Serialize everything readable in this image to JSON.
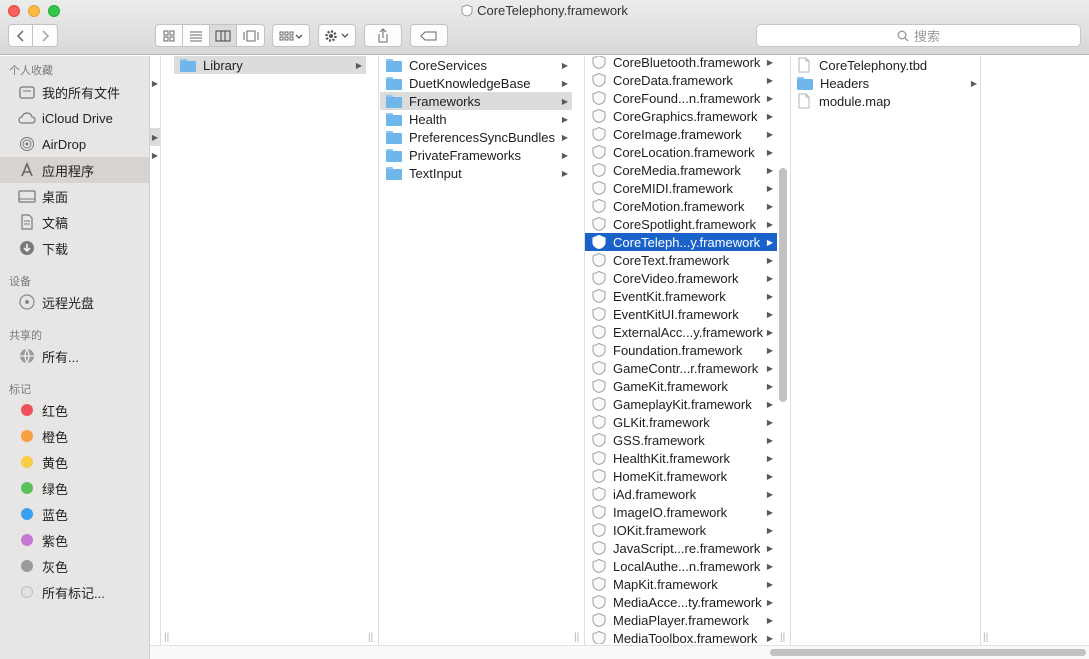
{
  "window": {
    "title": "CoreTelephony.framework",
    "lights": {
      "close": "#fc605b",
      "minimize": "#fdbc40",
      "zoom": "#34c84a"
    }
  },
  "toolbar": {
    "search_placeholder": "搜索",
    "icons": [
      "chevron-left-icon",
      "chevron-right-icon",
      "icon-view-icon",
      "list-view-icon",
      "column-view-icon",
      "coverflow-view-icon",
      "group-icon",
      "gear-icon",
      "share-icon",
      "tag-icon"
    ]
  },
  "sidebar": {
    "favorites_header": "个人收藏",
    "favorites": [
      {
        "label": "我的所有文件",
        "icon": "all-files-icon"
      },
      {
        "label": "iCloud Drive",
        "icon": "cloud-icon"
      },
      {
        "label": "AirDrop",
        "icon": "airdrop-icon"
      },
      {
        "label": "应用程序",
        "icon": "applications-icon",
        "selected": true
      },
      {
        "label": "桌面",
        "icon": "desktop-icon"
      },
      {
        "label": "文稿",
        "icon": "documents-icon"
      },
      {
        "label": "下载",
        "icon": "download-icon"
      }
    ],
    "devices_header": "设备",
    "devices": [
      {
        "label": "远程光盘",
        "icon": "disc-icon"
      }
    ],
    "shared_header": "共享的",
    "shared": [
      {
        "label": "所有...",
        "icon": "network-icon"
      }
    ],
    "tags_header": "标记",
    "tags": [
      {
        "label": "红色",
        "color": "#f0525a"
      },
      {
        "label": "橙色",
        "color": "#f5a041"
      },
      {
        "label": "黄色",
        "color": "#f7cd47"
      },
      {
        "label": "绿色",
        "color": "#5ac05b"
      },
      {
        "label": "蓝色",
        "color": "#3aa1f0"
      },
      {
        "label": "紫色",
        "color": "#c27ad5"
      },
      {
        "label": "灰色",
        "color": "#9a9a9a"
      },
      {
        "label": "所有标记...",
        "color": "#e2e2e2"
      }
    ]
  },
  "columns": {
    "library": [
      {
        "label": "Library",
        "selected": true
      }
    ],
    "library_children": [
      {
        "label": "CoreServices"
      },
      {
        "label": "DuetKnowledgeBase"
      },
      {
        "label": "Frameworks",
        "selected": true
      },
      {
        "label": "Health"
      },
      {
        "label": "PreferencesSyncBundles"
      },
      {
        "label": "PrivateFrameworks"
      },
      {
        "label": "TextInput"
      }
    ],
    "frameworks": [
      {
        "label": "CoreBluetooth.framework"
      },
      {
        "label": "CoreData.framework"
      },
      {
        "label": "CoreFound...n.framework"
      },
      {
        "label": "CoreGraphics.framework"
      },
      {
        "label": "CoreImage.framework"
      },
      {
        "label": "CoreLocation.framework"
      },
      {
        "label": "CoreMedia.framework"
      },
      {
        "label": "CoreMIDI.framework"
      },
      {
        "label": "CoreMotion.framework"
      },
      {
        "label": "CoreSpotlight.framework"
      },
      {
        "label": "CoreTeleph...y.framework",
        "highlighted": true
      },
      {
        "label": "CoreText.framework"
      },
      {
        "label": "CoreVideo.framework"
      },
      {
        "label": "EventKit.framework"
      },
      {
        "label": "EventKitUI.framework"
      },
      {
        "label": "ExternalAcc...y.framework"
      },
      {
        "label": "Foundation.framework"
      },
      {
        "label": "GameContr...r.framework"
      },
      {
        "label": "GameKit.framework"
      },
      {
        "label": "GameplayKit.framework"
      },
      {
        "label": "GLKit.framework"
      },
      {
        "label": "GSS.framework"
      },
      {
        "label": "HealthKit.framework"
      },
      {
        "label": "HomeKit.framework"
      },
      {
        "label": "iAd.framework"
      },
      {
        "label": "ImageIO.framework"
      },
      {
        "label": "IOKit.framework"
      },
      {
        "label": "JavaScript...re.framework"
      },
      {
        "label": "LocalAuthe...n.framework"
      },
      {
        "label": "MapKit.framework"
      },
      {
        "label": "MediaAcce...ty.framework"
      },
      {
        "label": "MediaPlayer.framework"
      },
      {
        "label": "MediaToolbox.framework"
      }
    ],
    "contents": [
      {
        "label": "CoreTelephony.tbd",
        "kind": "file"
      },
      {
        "label": "Headers",
        "kind": "folder"
      },
      {
        "label": "module.map",
        "kind": "file"
      }
    ]
  }
}
